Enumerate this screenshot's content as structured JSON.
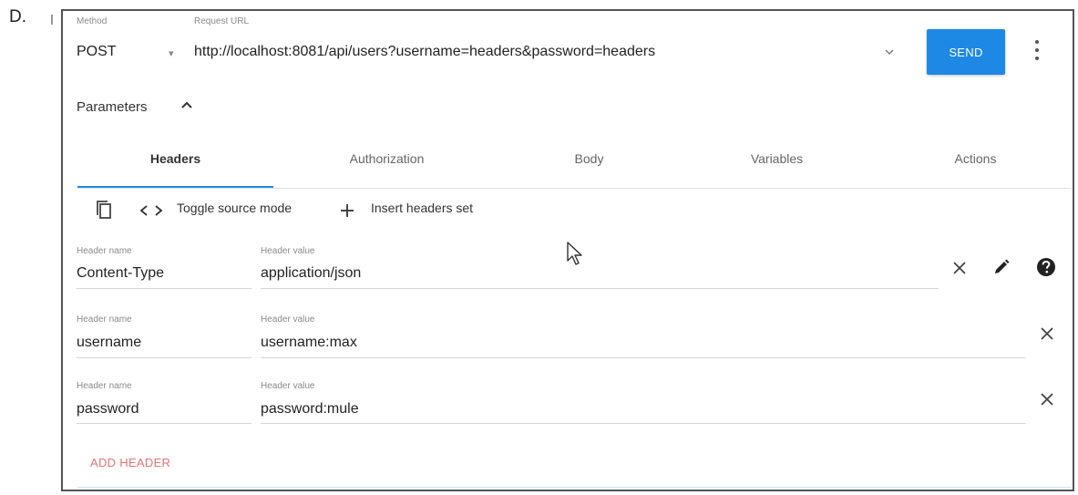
{
  "option_letter": "D.",
  "request": {
    "method_label": "Method",
    "method_value": "POST",
    "url_label": "Request URL",
    "url_value": "http://localhost:8081/api/users?username=headers&password=headers",
    "send_label": "SEND"
  },
  "parameters": {
    "label": "Parameters"
  },
  "tabs": [
    {
      "label": "Headers",
      "active": true
    },
    {
      "label": "Authorization",
      "active": false
    },
    {
      "label": "Body",
      "active": false
    },
    {
      "label": "Variables",
      "active": false
    },
    {
      "label": "Actions",
      "active": false
    }
  ],
  "toolbar": {
    "toggle_label": "Toggle source mode",
    "insert_label": "Insert headers set"
  },
  "headers": [
    {
      "name_label": "Header name",
      "name": "Content-Type",
      "value_label": "Header value",
      "value": "application/json"
    },
    {
      "name_label": "Header name",
      "name": "username",
      "value_label": "Header value",
      "value": "username:max"
    },
    {
      "name_label": "Header name",
      "name": "password",
      "value_label": "Header value",
      "value": "password:mule"
    }
  ],
  "add_header_label": "ADD HEADER",
  "colors": {
    "accent": "#1e88e5",
    "add_header": "#e57373"
  }
}
